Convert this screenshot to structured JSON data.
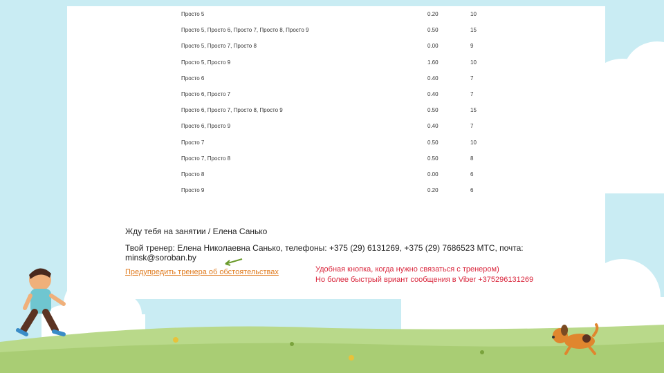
{
  "table": {
    "rows": [
      {
        "name": "Просто 5",
        "v1": "0.20",
        "v2": "10"
      },
      {
        "name": "Просто 5, Просто 6, Просто 7, Просто 8, Просто 9",
        "v1": "0.50",
        "v2": "15"
      },
      {
        "name": "Просто 5, Просто 7, Просто 8",
        "v1": "0.00",
        "v2": "9"
      },
      {
        "name": "Просто 5, Просто 9",
        "v1": "1.60",
        "v2": "10"
      },
      {
        "name": "Просто 6",
        "v1": "0.40",
        "v2": "7"
      },
      {
        "name": "Просто 6, Просто 7",
        "v1": "0.40",
        "v2": "7"
      },
      {
        "name": "Просто 6, Просто 7, Просто 8, Просто 9",
        "v1": "0.50",
        "v2": "15"
      },
      {
        "name": "Просто 6, Просто 9",
        "v1": "0.40",
        "v2": "7"
      },
      {
        "name": "Просто 7",
        "v1": "0.50",
        "v2": "10"
      },
      {
        "name": "Просто 7, Просто 8",
        "v1": "0.50",
        "v2": "8"
      },
      {
        "name": "Просто 8",
        "v1": "0.00",
        "v2": "6"
      },
      {
        "name": "Просто 9",
        "v1": "0.20",
        "v2": "6"
      }
    ]
  },
  "info": {
    "greeting": "Жду тебя на занятии / Елена Санько",
    "trainer": "Твой тренер: Елена Николаевна Санько, телефоны: +375 (29) 6131269, +375 (29) 7686523 МТС, почта: minsk@soroban.by",
    "warn_link": "Предупредить тренера об обстоятельствах",
    "note_line1": "Удобная кнопка, когда нужно связаться с тренером)",
    "note_line2": "Но более быстрый вриант сообщения в Viber +375296131269"
  },
  "colors": {
    "sky": "#c9ecf3",
    "grass": "#b9d98a",
    "link": "#e07b1f",
    "note": "#d9253b",
    "arrow": "#6a9a2a"
  }
}
